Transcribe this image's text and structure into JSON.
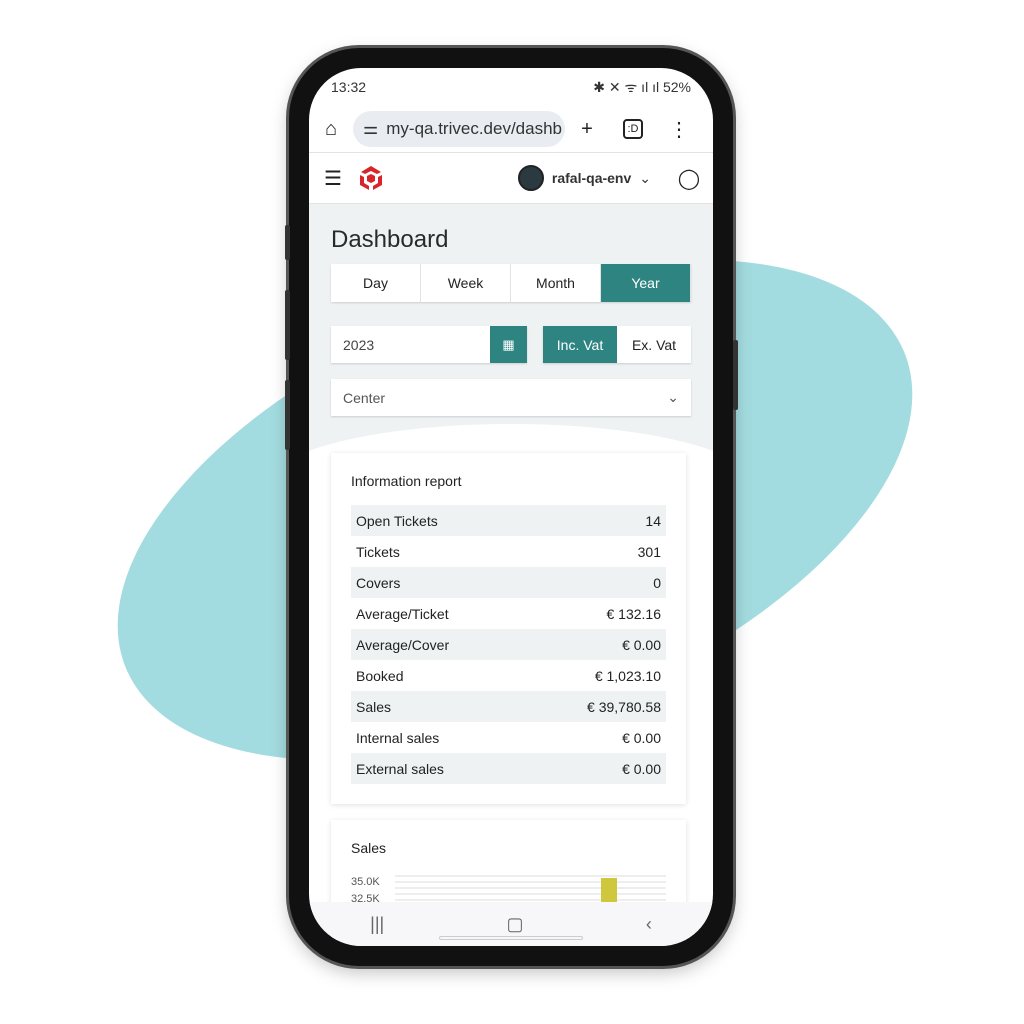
{
  "status": {
    "time": "13:32",
    "battery": "52%"
  },
  "browser": {
    "url": "my-qa.trivec.dev/dashb",
    "tabs_label": ":D"
  },
  "header": {
    "env_name": "rafal-qa-env"
  },
  "page": {
    "title": "Dashboard",
    "periods": [
      "Day",
      "Week",
      "Month",
      "Year"
    ],
    "active_period": "Year",
    "year": "2023",
    "vat_options": [
      "Inc. Vat",
      "Ex. Vat"
    ],
    "active_vat": "Inc. Vat",
    "center_placeholder": "Center"
  },
  "report": {
    "title": "Information report",
    "rows": [
      {
        "label": "Open Tickets",
        "value": "14"
      },
      {
        "label": "Tickets",
        "value": "301"
      },
      {
        "label": "Covers",
        "value": "0"
      },
      {
        "label": "Average/Ticket",
        "value": "€ 132.16"
      },
      {
        "label": "Average/Cover",
        "value": "€ 0.00"
      },
      {
        "label": "Booked",
        "value": "€ 1,023.10"
      },
      {
        "label": "Sales",
        "value": "€ 39,780.58"
      },
      {
        "label": "Internal sales",
        "value": "€ 0.00"
      },
      {
        "label": "External sales",
        "value": "€ 0.00"
      }
    ]
  },
  "sales": {
    "title": "Sales"
  },
  "chart_data": {
    "type": "bar",
    "title": "Sales",
    "yticks": [
      "35.0K",
      "32.5K"
    ],
    "bar_color": "#cfc83e",
    "visible_bar_top": 35000
  },
  "colors": {
    "accent": "#2e8480",
    "blob": "#a3dce0"
  }
}
